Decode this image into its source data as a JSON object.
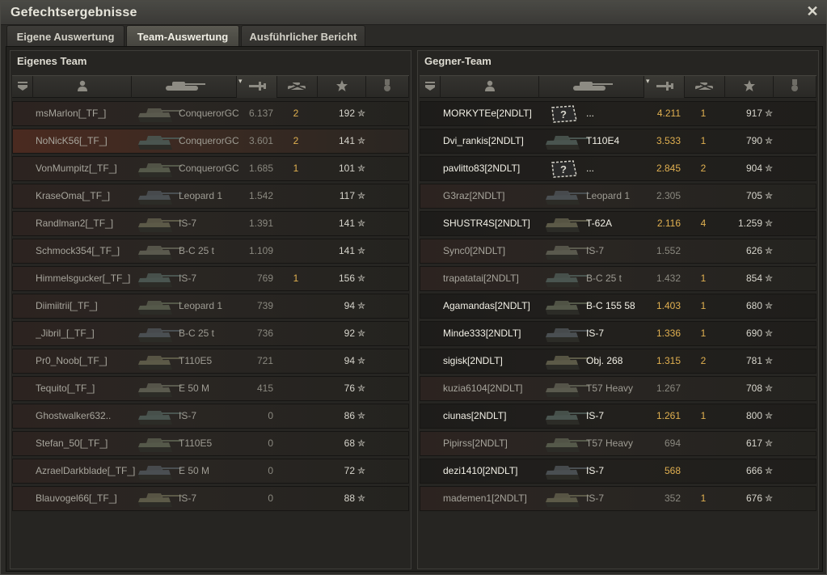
{
  "window": {
    "title": "Gefechtsergebnisse",
    "close_glyph": "✕"
  },
  "tabs": [
    {
      "label": "Eigene Auswertung",
      "active": false
    },
    {
      "label": "Team-Auswertung",
      "active": true
    },
    {
      "label": "Ausführlicher Bericht",
      "active": false
    }
  ],
  "columns": {
    "icons": [
      "squad-icon",
      "player-icon",
      "tank-icon",
      "damage-icon",
      "frags-icon",
      "xp-star-icon",
      "medal-icon"
    ],
    "sorted_column": "damage"
  },
  "star_glyph": "✮",
  "colors": {
    "damage_highlight": "#e0b050",
    "accent_row": "#4a2a20"
  },
  "own_team": {
    "title": "Eigenes Team",
    "rows": [
      {
        "player": "msMarlon[_TF_]",
        "vehicle": "ConquerorGC",
        "damage": "6.137",
        "frags": "2",
        "xp": "192"
      },
      {
        "player": "NoNicK56[_TF_]",
        "vehicle": "ConquerorGC",
        "damage": "3.601",
        "frags": "2",
        "xp": "141"
      },
      {
        "player": "VonMumpitz[_TF_]",
        "vehicle": "ConquerorGC",
        "damage": "1.685",
        "frags": "1",
        "xp": "101"
      },
      {
        "player": "KraseOma[_TF_]",
        "vehicle": "Leopard 1",
        "damage": "1.542",
        "frags": "",
        "xp": "117"
      },
      {
        "player": "Randlman2[_TF_]",
        "vehicle": "IS-7",
        "damage": "1.391",
        "frags": "",
        "xp": "141"
      },
      {
        "player": "Schmock354[_TF_]",
        "vehicle": "B-C 25 t",
        "damage": "1.109",
        "frags": "",
        "xp": "141"
      },
      {
        "player": "Himmelsgucker[_TF_]",
        "vehicle": "IS-7",
        "damage": "769",
        "frags": "1",
        "xp": "156"
      },
      {
        "player": "Diimiitrii[_TF_]",
        "vehicle": "Leopard 1",
        "damage": "739",
        "frags": "",
        "xp": "94"
      },
      {
        "player": "_Jibril_[_TF_]",
        "vehicle": "B-C 25 t",
        "damage": "736",
        "frags": "",
        "xp": "92"
      },
      {
        "player": "Pr0_Noob[_TF_]",
        "vehicle": "T110E5",
        "damage": "721",
        "frags": "",
        "xp": "94"
      },
      {
        "player": "Tequito[_TF_]",
        "vehicle": "E 50 M",
        "damage": "415",
        "frags": "",
        "xp": "76"
      },
      {
        "player": "Ghostwalker632..",
        "vehicle": "IS-7",
        "damage": "0",
        "frags": "",
        "xp": "86"
      },
      {
        "player": "Stefan_50[_TF_]",
        "vehicle": "T110E5",
        "damage": "0",
        "frags": "",
        "xp": "68"
      },
      {
        "player": "AzraelDarkblade[_TF_]",
        "vehicle": "E 50 M",
        "damage": "0",
        "frags": "",
        "xp": "72"
      },
      {
        "player": "Blauvogel66[_TF_]",
        "vehicle": "IS-7",
        "damage": "0",
        "frags": "",
        "xp": "88"
      }
    ]
  },
  "enemy_team": {
    "title": "Gegner-Team",
    "rows": [
      {
        "player": "MORKYTEe[2NDLT]",
        "vehicle": "...",
        "damage": "4.211",
        "frags": "1",
        "xp": "917",
        "bright": true,
        "unknown": true
      },
      {
        "player": "Dvi_rankis[2NDLT]",
        "vehicle": "T110E4",
        "damage": "3.533",
        "frags": "1",
        "xp": "790",
        "bright": true
      },
      {
        "player": "pavlitto83[2NDLT]",
        "vehicle": "...",
        "damage": "2.845",
        "frags": "2",
        "xp": "904",
        "bright": true,
        "unknown": true
      },
      {
        "player": "G3raz[2NDLT]",
        "vehicle": "Leopard 1",
        "damage": "2.305",
        "frags": "",
        "xp": "705",
        "bright": false
      },
      {
        "player": "SHUSTR4S[2NDLT]",
        "vehicle": "T-62A",
        "damage": "2.116",
        "frags": "4",
        "xp": "1.259",
        "bright": true
      },
      {
        "player": "Sync0[2NDLT]",
        "vehicle": "IS-7",
        "damage": "1.552",
        "frags": "",
        "xp": "626",
        "bright": false
      },
      {
        "player": "trapatatai[2NDLT]",
        "vehicle": "B-C 25 t",
        "damage": "1.432",
        "frags": "1",
        "xp": "854",
        "bright": false
      },
      {
        "player": "Agamandas[2NDLT]",
        "vehicle": "B-C 155 58",
        "damage": "1.403",
        "frags": "1",
        "xp": "680",
        "bright": true
      },
      {
        "player": "Minde333[2NDLT]",
        "vehicle": "IS-7",
        "damage": "1.336",
        "frags": "1",
        "xp": "690",
        "bright": true
      },
      {
        "player": "sigisk[2NDLT]",
        "vehicle": "Obj. 268",
        "damage": "1.315",
        "frags": "2",
        "xp": "781",
        "bright": true
      },
      {
        "player": "kuzia6104[2NDLT]",
        "vehicle": "T57 Heavy",
        "damage": "1.267",
        "frags": "",
        "xp": "708",
        "bright": false
      },
      {
        "player": "ciunas[2NDLT]",
        "vehicle": "IS-7",
        "damage": "1.261",
        "frags": "1",
        "xp": "800",
        "bright": true
      },
      {
        "player": "Pipirss[2NDLT]",
        "vehicle": "T57 Heavy",
        "damage": "694",
        "frags": "",
        "xp": "617",
        "bright": false
      },
      {
        "player": "dezi1410[2NDLT]",
        "vehicle": "IS-7",
        "damage": "568",
        "frags": "",
        "xp": "666",
        "bright": true
      },
      {
        "player": "mademen1[2NDLT]",
        "vehicle": "IS-7",
        "damage": "352",
        "frags": "1",
        "xp": "676",
        "bright": false
      }
    ]
  }
}
